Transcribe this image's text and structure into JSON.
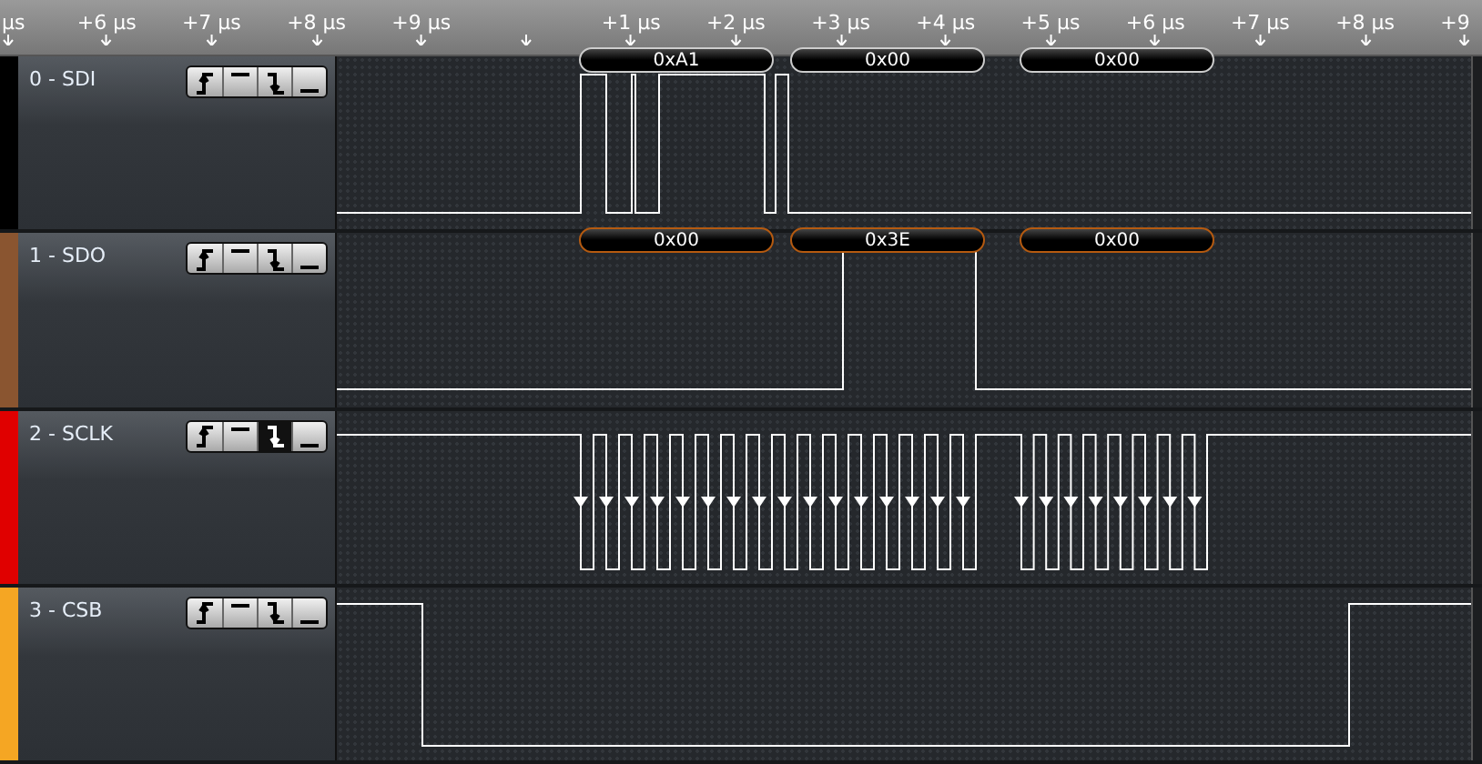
{
  "ruler": {
    "ticks": [
      {
        "kind": "label",
        "label": "µs"
      },
      {
        "kind": "label",
        "label": "+6 µs"
      },
      {
        "kind": "label",
        "label": "+7 µs"
      },
      {
        "kind": "label",
        "label": "+8 µs"
      },
      {
        "kind": "label",
        "label": "+9 µs"
      },
      {
        "kind": "marker"
      },
      {
        "kind": "label",
        "label": "+1 µs"
      },
      {
        "kind": "label",
        "label": "+2 µs"
      },
      {
        "kind": "label",
        "label": "+3 µs"
      },
      {
        "kind": "label",
        "label": "+4 µs"
      },
      {
        "kind": "label",
        "label": "+5 µs"
      },
      {
        "kind": "label",
        "label": "+6 µs"
      },
      {
        "kind": "label",
        "label": "+7 µs"
      },
      {
        "kind": "label",
        "label": "+8 µs"
      },
      {
        "kind": "label",
        "label": "+9"
      }
    ]
  },
  "channels": [
    {
      "name": "0 - SDI",
      "color": "#000000",
      "triggers": [
        {
          "kind": "rising",
          "selected": false
        },
        {
          "kind": "high",
          "selected": false
        },
        {
          "kind": "falling",
          "selected": false
        },
        {
          "kind": "low",
          "selected": false
        }
      ],
      "decoded": [
        "0xA1",
        "0x00",
        "0x00"
      ]
    },
    {
      "name": "1 - SDO",
      "color": "#8a5530",
      "triggers": [
        {
          "kind": "rising",
          "selected": false
        },
        {
          "kind": "high",
          "selected": false
        },
        {
          "kind": "falling",
          "selected": false
        },
        {
          "kind": "low",
          "selected": false
        }
      ],
      "decoded": [
        "0x00",
        "0x3E",
        "0x00"
      ]
    },
    {
      "name": "2 - SCLK",
      "color": "#e00000",
      "triggers": [
        {
          "kind": "rising",
          "selected": false
        },
        {
          "kind": "high",
          "selected": false
        },
        {
          "kind": "falling",
          "selected": true
        },
        {
          "kind": "low",
          "selected": false
        }
      ]
    },
    {
      "name": "3 - CSB",
      "color": "#f5a623",
      "triggers": [
        {
          "kind": "rising",
          "selected": false
        },
        {
          "kind": "high",
          "selected": false
        },
        {
          "kind": "falling",
          "selected": false
        },
        {
          "kind": "low",
          "selected": false
        }
      ]
    }
  ]
}
